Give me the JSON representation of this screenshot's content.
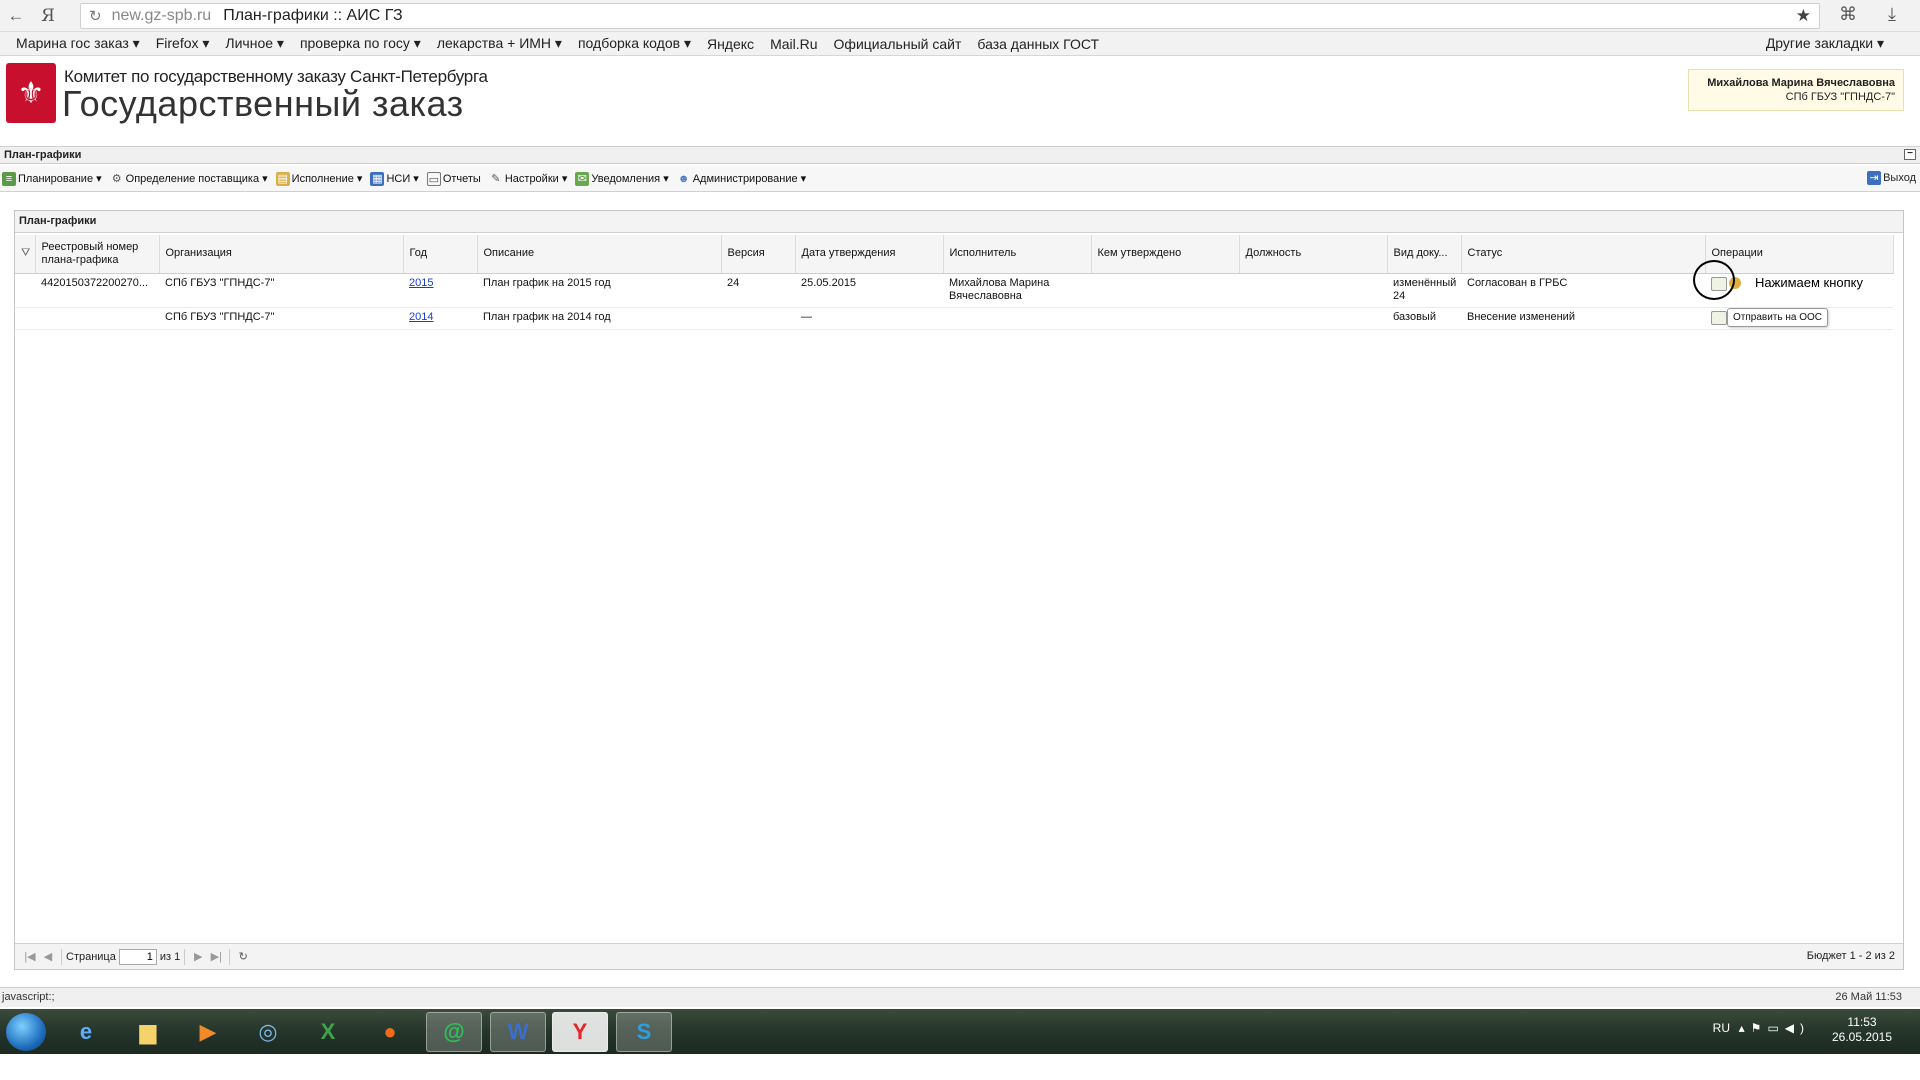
{
  "browser": {
    "domain": "new.gz-spb.ru",
    "page_title": "План-графики :: АИС ГЗ",
    "bookmarks": [
      "Марина гос заказ ▾",
      "Firefox ▾",
      "Личное ▾",
      "проверка по госу ▾",
      "лекарства + ИМН ▾",
      "подборка кодов ▾",
      "Яндекс",
      "Mail.Ru",
      "Официальный сайт",
      "база данных ГОСТ"
    ],
    "other_bookmarks": "Другие закладки ▾"
  },
  "header": {
    "org_line": "Комитет по государственному заказу Санкт-Петербурга",
    "system_title": "Государственный заказ",
    "user_name": "Михайлова Марина Вячеславовна",
    "user_org": "СПб ГБУЗ \"ГПНДС-7\""
  },
  "panel": {
    "title": "План-графики"
  },
  "toolbar": {
    "items": [
      {
        "label": "Планирование ▾",
        "icon": "planning-icon"
      },
      {
        "label": "Определение поставщика ▾",
        "icon": "supplier-icon"
      },
      {
        "label": "Исполнение ▾",
        "icon": "execution-icon"
      },
      {
        "label": "НСИ ▾",
        "icon": "reference-icon"
      },
      {
        "label": "Отчеты",
        "icon": "reports-icon"
      },
      {
        "label": "Настройки ▾",
        "icon": "settings-icon"
      },
      {
        "label": "Уведомления ▾",
        "icon": "notifications-icon"
      },
      {
        "label": "Администрирование ▾",
        "icon": "admin-icon"
      }
    ],
    "logout": "Выход"
  },
  "grid": {
    "title": "План-графики",
    "columns": [
      "Реестровый номер плана-графика",
      "Организация",
      "Год",
      "Описание",
      "Версия",
      "Дата утверждения",
      "Исполнитель",
      "Кем утверждено",
      "Должность",
      "Вид доку...",
      "Статус",
      "Операции"
    ],
    "rows": [
      {
        "reg_no": "4420150372200270...",
        "org": "СПб ГБУЗ \"ГПНДС-7\"",
        "year": "2015",
        "desc": "План график на 2015 год",
        "version": "24",
        "date": "25.05.2015",
        "executor": "Михайлова Марина Вячеславовна",
        "approved_by": "",
        "position": "",
        "doc_type": "изменённый 24",
        "status": "Согласован в ГРБС"
      },
      {
        "reg_no": "",
        "org": "СПб ГБУЗ \"ГПНДС-7\"",
        "year": "2014",
        "desc": "План график на 2014 год",
        "version": "",
        "date": "—",
        "executor": "",
        "approved_by": "",
        "position": "",
        "doc_type": "базовый",
        "status": "Внесение изменений"
      }
    ],
    "annotation": "Нажимаем кнопку",
    "tooltip": "Отправить на ООС"
  },
  "pager": {
    "page_label": "Страница",
    "page_value": "1",
    "of_label": "из 1",
    "info": "Бюджет 1 - 2 из 2"
  },
  "statusbar": {
    "left": "javascript:;",
    "right": "26 Май 11:53"
  },
  "taskbar": {
    "lang": "RU",
    "time": "11:53",
    "date": "26.05.2015"
  }
}
